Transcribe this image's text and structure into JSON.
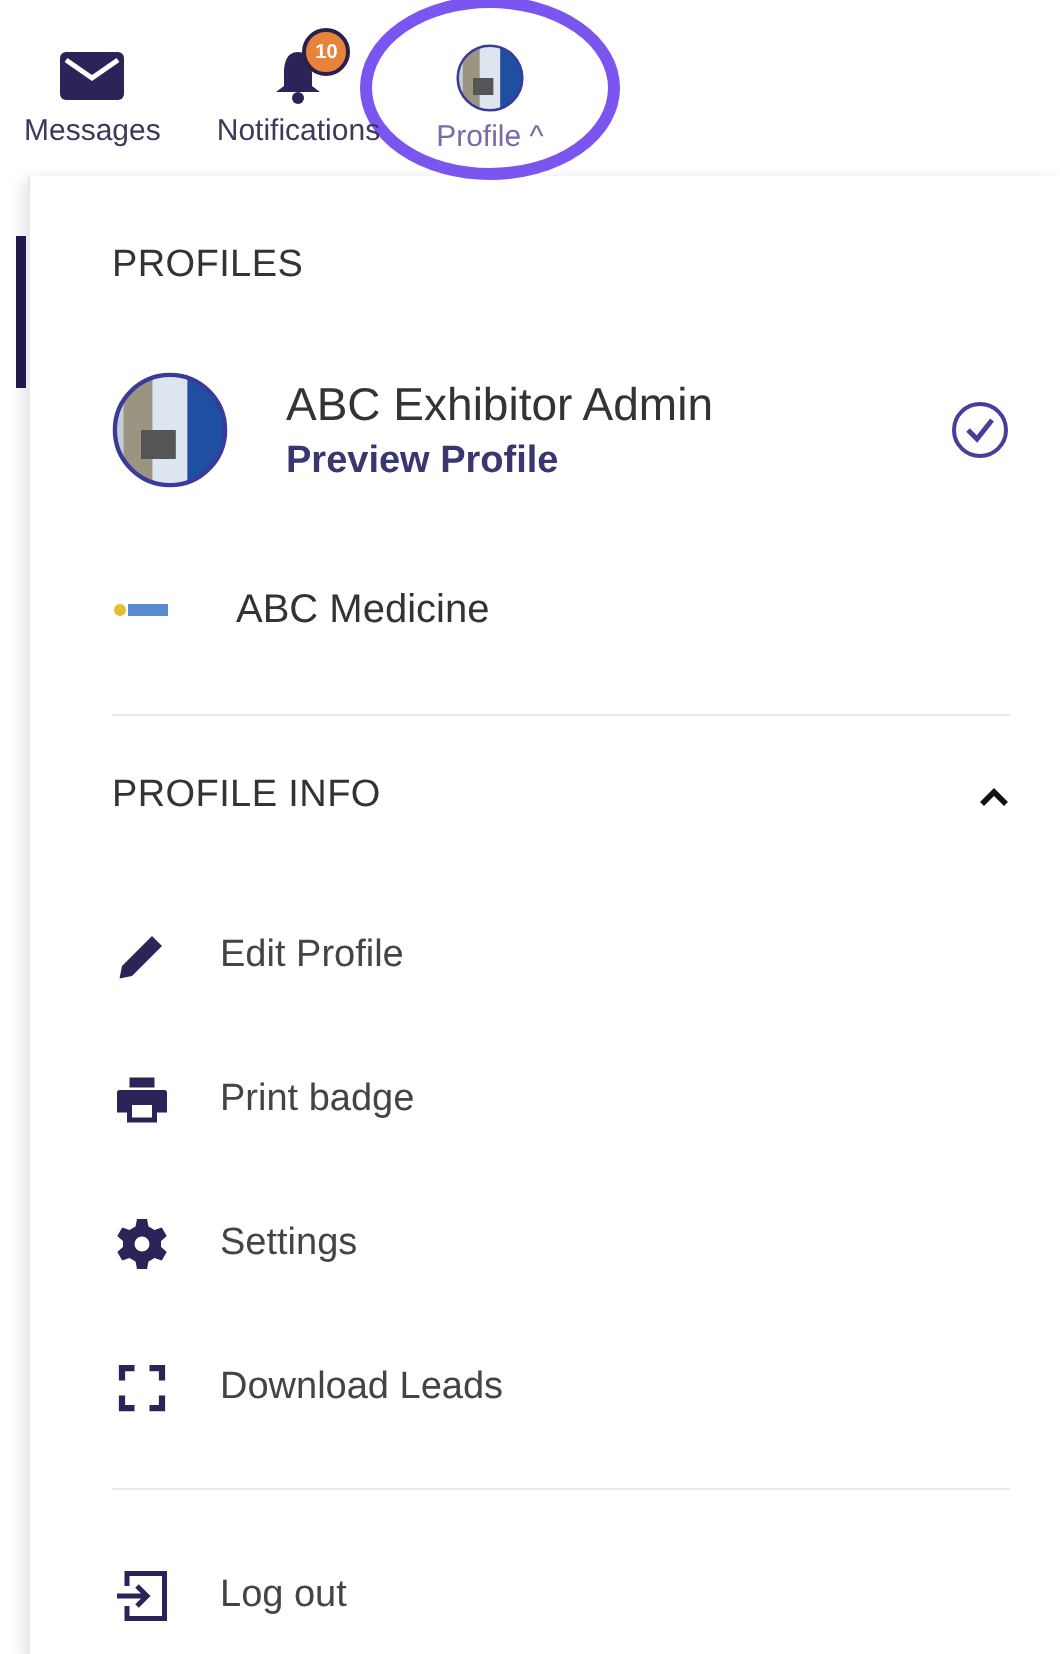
{
  "nav": [
    {
      "kind": "mail",
      "label": "Messages",
      "selected": false
    },
    {
      "kind": "bell",
      "label": "Notifications",
      "badge": "10",
      "selected": false
    },
    {
      "kind": "avatar",
      "label": "Profile",
      "caret": "^",
      "selected": true
    }
  ],
  "profiles": {
    "title": "PROFILES",
    "items": [
      {
        "kind": "avatar",
        "name": "ABC Exhibitor Admin",
        "link": "Preview Profile",
        "selected": true
      },
      {
        "kind": "logo",
        "name": "ABC Medicine",
        "selected": false
      }
    ]
  },
  "profile_info": {
    "title": "PROFILE INFO",
    "expanded": true,
    "items": [
      {
        "kind": "pencil",
        "label": "Edit Profile"
      },
      {
        "kind": "printer",
        "label": "Print badge"
      },
      {
        "kind": "gear",
        "label": "Settings"
      },
      {
        "kind": "frame",
        "label": "Download Leads"
      }
    ]
  },
  "logout": {
    "label": "Log out"
  }
}
